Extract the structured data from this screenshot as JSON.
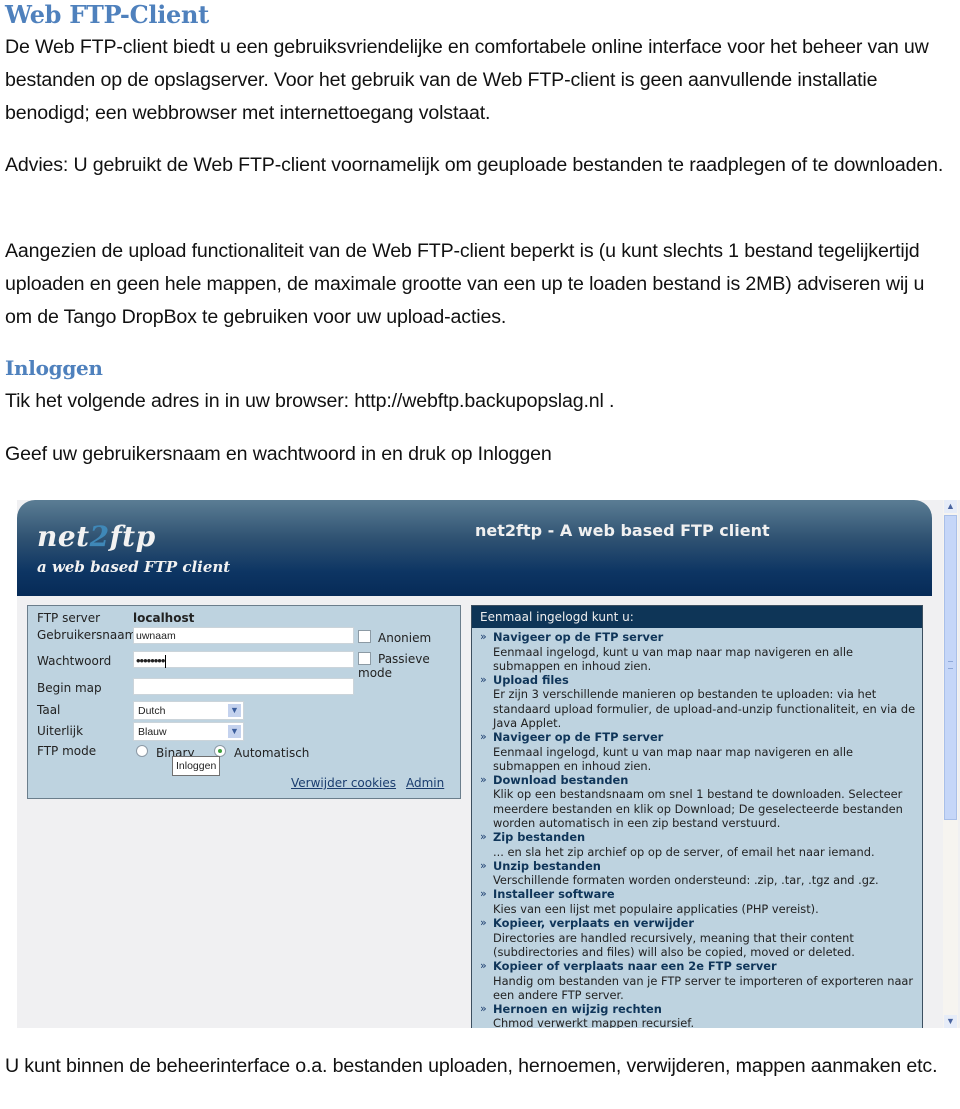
{
  "document": {
    "title": "Web FTP-Client",
    "intro": "De Web FTP-client biedt u een gebruiksvriendelijke en comfortabele online interface voor het beheer van uw bestanden op de opslagserver. Voor het gebruik van de Web FTP-client is geen aanvullende installatie benodigd; een webbrowser met internettoegang volstaat.",
    "advice": "Advies: U gebruikt de Web FTP-client voornamelijk om geuploade bestanden te raadplegen of te downloaden.",
    "upload_note": "Aangezien de upload functionaliteit van de Web FTP-client beperkt is (u kunt slechts 1 bestand tegelijkertijd uploaden en geen hele mappen, de maximale grootte van een up te loaden bestand is 2MB) adviseren wij u om de Tango DropBox te gebruiken voor uw upload-acties.",
    "login_heading": "Inloggen",
    "login_step1": "Tik het volgende adres in in uw browser: http://webftp.backupopslag.nl .",
    "login_step2": "Geef uw gebruikersnaam en wachtwoord in en druk op Inloggen",
    "closing": "U kunt binnen de beheerinterface o.a. bestanden uploaden, hernoemen, verwijderen, mappen aanmaken etc."
  },
  "screenshot": {
    "logo_main_a": "net",
    "logo_main_b": "2",
    "logo_main_c": "ftp",
    "logo_sub": "a web based FTP client",
    "header_title": "net2ftp - A web based FTP client",
    "login_form": {
      "ftp_server_label": "FTP server",
      "ftp_server_value": "localhost",
      "username_label": "Gebruikersnaam",
      "username_value": "uwnaam",
      "password_label": "Wachtwoord",
      "password_value": "••••••••",
      "anonymous_label": "Anoniem",
      "passive_label_1": "Passieve",
      "passive_label_2": "mode",
      "startdir_label": "Begin map",
      "startdir_value": "",
      "language_label": "Taal",
      "language_value": "Dutch",
      "skin_label": "Uiterlijk",
      "skin_value": "Blauw",
      "ftpmode_label": "FTP mode",
      "ftpmode_binary": "Binary",
      "ftpmode_auto": "Automatisch",
      "ftpmode_selected": "Automatisch",
      "login_button": "Inloggen",
      "clear_cookies_link": "Verwijder cookies",
      "admin_link": "Admin"
    },
    "info": {
      "heading": "Eenmaal ingelogd kunt u:",
      "items": [
        {
          "title": "Navigeer op de FTP server",
          "desc": "Eenmaal ingelogd, kunt u van map naar map navigeren en alle submappen en inhoud zien."
        },
        {
          "title": "Upload files",
          "desc": "Er zijn 3 verschillende manieren op bestanden te uploaden: via het standaard upload formulier, de upload-and-unzip functionaliteit, en via de Java Applet."
        },
        {
          "title": "Navigeer op de FTP server",
          "desc": "Eenmaal ingelogd, kunt u van map naar map navigeren en alle submappen en inhoud zien."
        },
        {
          "title": "Download bestanden",
          "desc": "Klik op een bestandsnaam om snel 1 bestand te downloaden. Selecteer meerdere bestanden en klik op Download; De geselecteerde bestanden worden automatisch in een zip bestand verstuurd."
        },
        {
          "title": "Zip bestanden",
          "desc": "... en sla het zip archief op op de server, of email het naar iemand."
        },
        {
          "title": "Unzip bestanden",
          "desc": "Verschillende formaten worden ondersteund: .zip, .tar, .tgz and .gz."
        },
        {
          "title": "Installeer software",
          "desc": "Kies van een lijst met populaire applicaties (PHP vereist)."
        },
        {
          "title": "Kopieer, verplaats en verwijder",
          "desc": "Directories are handled recursively, meaning that their content (subdirectories and files) will also be copied, moved or deleted."
        },
        {
          "title": "Kopieer of verplaats naar een 2e FTP server",
          "desc": "Handig om bestanden van je FTP server te importeren of exporteren naar een andere FTP server."
        },
        {
          "title": "Hernoen en wijzig rechten",
          "desc": "Chmod verwerkt mappen recursief."
        }
      ]
    },
    "scrollbar": {
      "up_icon": "▲",
      "down_icon": "▼"
    }
  }
}
